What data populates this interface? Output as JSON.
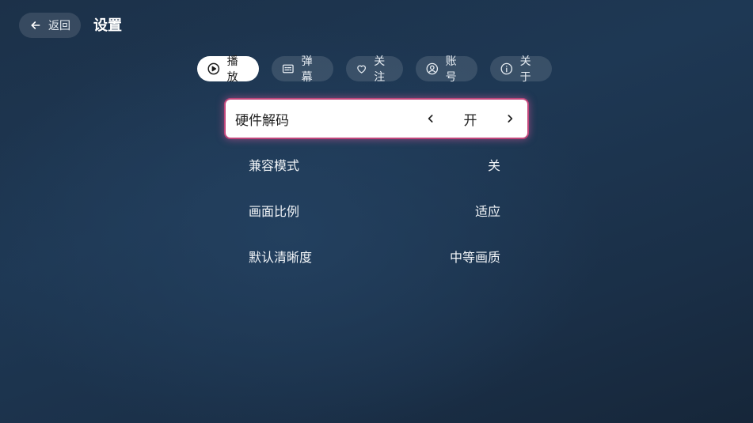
{
  "header": {
    "back_label": "返回",
    "title": "设置"
  },
  "tabs": [
    {
      "label": "播放",
      "icon": "play-circle-icon",
      "active": true
    },
    {
      "label": "弹幕",
      "icon": "subtitles-icon",
      "active": false
    },
    {
      "label": "关注",
      "icon": "heart-icon",
      "active": false
    },
    {
      "label": "账号",
      "icon": "account-circle-icon",
      "active": false
    },
    {
      "label": "关于",
      "icon": "info-icon",
      "active": false
    }
  ],
  "settings": [
    {
      "label": "硬件解码",
      "value": "开",
      "focused": true
    },
    {
      "label": "兼容模式",
      "value": "关",
      "focused": false
    },
    {
      "label": "画面比例",
      "value": "适应",
      "focused": false
    },
    {
      "label": "默认清晰度",
      "value": "中等画质",
      "focused": false
    }
  ],
  "colors": {
    "background": "#1e3854",
    "focus_border": "#c0467b",
    "active_tab": "#ffffff"
  }
}
